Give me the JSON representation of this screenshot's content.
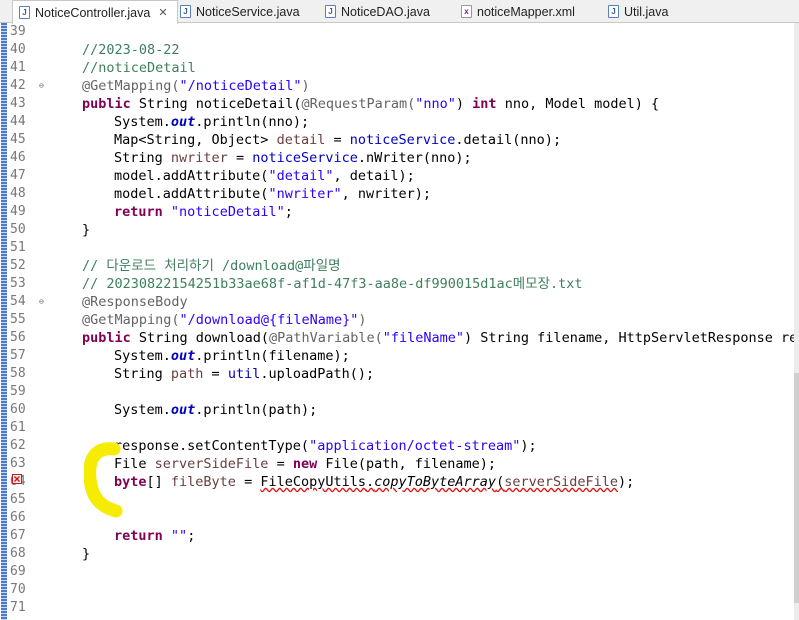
{
  "tabs": [
    {
      "label": "NoticeController.java",
      "active": true,
      "icon": "java-file-icon"
    },
    {
      "label": "NoticeService.java",
      "active": false,
      "icon": "java-file-icon"
    },
    {
      "label": "NoticeDAO.java",
      "active": false,
      "icon": "java-file-icon"
    },
    {
      "label": "noticeMapper.xml",
      "active": false,
      "icon": "xml-file-icon"
    },
    {
      "label": "Util.java",
      "active": false,
      "icon": "java-file-icon"
    }
  ],
  "close_glyph": "✕",
  "colors": {
    "comment": "#3f7f5f",
    "keyword": "#7f0055",
    "annotation": "#646464",
    "string": "#2a00ff",
    "field": "#0000c0",
    "highlight": "#f5ec00",
    "error": "#e01818"
  },
  "line_numbers": [
    "39",
    "40",
    "41",
    "42",
    "43",
    "44",
    "45",
    "46",
    "47",
    "48",
    "49",
    "50",
    "51",
    "52",
    "53",
    "54",
    "55",
    "56",
    "57",
    "58",
    "59",
    "60",
    "61",
    "62",
    "63",
    "64",
    "65",
    "66",
    "67",
    "68",
    "69",
    "70",
    "71"
  ],
  "fold_markers": {
    "42": "⊖",
    "54": "⊖"
  },
  "code": {
    "l40": "//2023-08-22",
    "l41": "//noticeDetail",
    "l42": [
      "@GetMapping(",
      "\"/noticeDetail\"",
      ")"
    ],
    "l43": [
      "public",
      " String noticeDetail(",
      "@RequestParam(",
      "\"nno\"",
      ") ",
      "int",
      " nno, Model model) {"
    ],
    "l44": [
      "System.",
      "out",
      ".println(nno);"
    ],
    "l45": [
      "Map<String, Object> ",
      "detail",
      " = ",
      "noticeService",
      ".detail(nno);"
    ],
    "l46": [
      "String ",
      "nwriter",
      " = ",
      "noticeService",
      ".nWriter(nno);"
    ],
    "l47": [
      "model.addAttribute(",
      "\"detail\"",
      ", detail);"
    ],
    "l48": [
      "model.addAttribute(",
      "\"nwriter\"",
      ", nwriter);"
    ],
    "l49": [
      "return",
      " ",
      "\"noticeDetail\"",
      ";"
    ],
    "l50": "}",
    "l52": "// 다운로드 처리하기 /download@파일명",
    "l53": "// 20230822154251b33ae68f-af1d-47f3-aa8e-df990015d1ac메모장.txt",
    "l54": "@ResponseBody",
    "l55": [
      "@GetMapping(",
      "\"/download@{fileName}\"",
      ")"
    ],
    "l56": [
      "public",
      " String download(",
      "@PathVariable(",
      "\"fileName\"",
      ") String filename, HttpServletResponse res"
    ],
    "l57": [
      "System.",
      "out",
      ".println(filename);"
    ],
    "l58": [
      "String ",
      "path",
      " = ",
      "util",
      ".uploadPath();"
    ],
    "l60": [
      "System.",
      "out",
      ".println(path);"
    ],
    "l62": [
      "response.setContentType(",
      "\"application/octet-stream\"",
      ");"
    ],
    "l63": [
      "File ",
      "serverSideFile",
      " = ",
      "new",
      " File(path, filename);"
    ],
    "l64": [
      "byte",
      "[] ",
      "fileByte",
      " = ",
      "FileCopyUtils",
      ".",
      "copyToByteArray",
      "(",
      "serverSideFile",
      ");"
    ],
    "l67": [
      "return",
      " ",
      "\"\"",
      ";"
    ],
    "l68": "}"
  }
}
